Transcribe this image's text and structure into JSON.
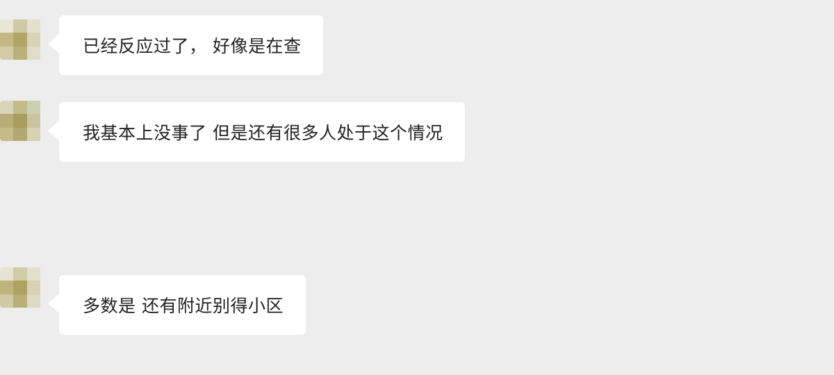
{
  "chat": {
    "messages": [
      {
        "text": "已经反应过了， 好像是在查"
      },
      {
        "text": "我基本上没事了 但是还有很多人处于这个情况"
      },
      {
        "text": "多数是 还有附近别得小区"
      }
    ]
  },
  "avatar": {
    "description_icon": "pixelated-avatar-icon",
    "colors": [
      "#e6e1cc",
      "#c6bf97",
      "#ddd8bd",
      "#bdb27a",
      "#a89b5b",
      "#d4cfb0",
      "#cfc8a4",
      "#b8ad78",
      "#e1ddc8"
    ]
  }
}
